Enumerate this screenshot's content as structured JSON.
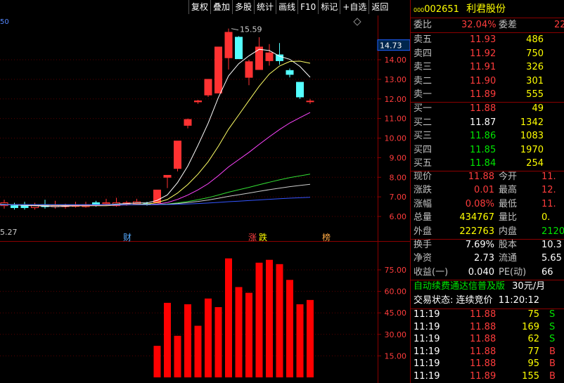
{
  "toolbar": [
    "复权",
    "叠加",
    "多股",
    "统计",
    "画线",
    "F10",
    "标记",
    "+自选",
    "返回"
  ],
  "stock": {
    "code_prefix": "000",
    "code": "002651",
    "name": "利君股份"
  },
  "weibi": {
    "label": "委比",
    "value": "32.04%",
    "label2": "委差",
    "value2": "22"
  },
  "sell": [
    {
      "label": "卖五",
      "price": "11.93",
      "vol": "486"
    },
    {
      "label": "卖四",
      "price": "11.92",
      "vol": "750"
    },
    {
      "label": "卖三",
      "price": "11.91",
      "vol": "326"
    },
    {
      "label": "卖二",
      "price": "11.90",
      "vol": "301"
    },
    {
      "label": "卖一",
      "price": "11.89",
      "vol": "555"
    }
  ],
  "buy": [
    {
      "label": "买一",
      "price": "11.88",
      "vol": "49"
    },
    {
      "label": "买二",
      "price": "11.87",
      "vol": "1342"
    },
    {
      "label": "买三",
      "price": "11.86",
      "vol": "1083"
    },
    {
      "label": "买四",
      "price": "11.85",
      "vol": "1970"
    },
    {
      "label": "买五",
      "price": "11.84",
      "vol": "254"
    }
  ],
  "quote": [
    {
      "l1": "现价",
      "v1": "11.88",
      "l2": "今开",
      "v2": "11."
    },
    {
      "l1": "涨跌",
      "v1": "0.01",
      "l2": "最高",
      "v2": "12."
    },
    {
      "l1": "涨幅",
      "v1": "0.08%",
      "l2": "最低",
      "v2": "11."
    },
    {
      "l1": "总量",
      "v1": "434767",
      "l2": "量比",
      "v2": "0."
    },
    {
      "l1": "外盘",
      "v1": "222763",
      "l2": "内盘",
      "v2": "2120"
    }
  ],
  "stats": [
    {
      "l1": "换手",
      "v1": "7.69%",
      "l2": "股本",
      "v2": "10.3"
    },
    {
      "l1": "净资",
      "v1": "2.73",
      "l2": "流通",
      "v2": "5.65"
    },
    {
      "l1": "收益(一)",
      "v1": "0.040",
      "l2": "PE(动)",
      "v2": "66"
    }
  ],
  "ad": {
    "text": "自动续费通达信普及版",
    "price": "30元/月"
  },
  "trade_status": {
    "label": "交易状态:",
    "value": "连续竞价",
    "time": "11:20:12"
  },
  "ticks": [
    {
      "time": "11:19",
      "price": "11.88",
      "vol": "75",
      "side": "S"
    },
    {
      "time": "11:19",
      "price": "11.88",
      "vol": "169",
      "side": "S"
    },
    {
      "time": "11:19",
      "price": "11.88",
      "vol": "62",
      "side": "S"
    },
    {
      "time": "11:19",
      "price": "11.88",
      "vol": "77",
      "side": "B"
    },
    {
      "time": "11:19",
      "price": "11.88",
      "vol": "95",
      "side": "B"
    },
    {
      "time": "11:19",
      "price": "11.89",
      "vol": "155",
      "side": "B"
    }
  ],
  "kline": {
    "price_axis": [
      "14.00",
      "13.00",
      "12.00",
      "11.00",
      "10.00",
      "9.00",
      "8.00",
      "7.00",
      "6.00"
    ],
    "current_price_tag": "14.73",
    "high_label": "15.59",
    "low_label": "5.27",
    "top_left_label": "50",
    "markers": [
      {
        "text": "财",
        "color": "#55aaff"
      },
      {
        "text": "涨",
        "color": "#ff4040"
      },
      {
        "text": "跌",
        "color": "#ffff00"
      },
      {
        "text": "榜",
        "color": "#ffaa44"
      }
    ],
    "candles": [
      {
        "o": 6.55,
        "c": 6.7,
        "h": 6.85,
        "l": 6.4
      },
      {
        "o": 6.55,
        "c": 6.45,
        "h": 6.7,
        "l": 6.35
      },
      {
        "o": 6.6,
        "c": 6.45,
        "h": 6.75,
        "l": 6.35
      },
      {
        "o": 6.45,
        "c": 6.55,
        "h": 6.7,
        "l": 6.35
      },
      {
        "o": 6.6,
        "c": 6.5,
        "h": 6.85,
        "l": 6.4
      },
      {
        "o": 6.5,
        "c": 6.55,
        "h": 6.8,
        "l": 6.4
      },
      {
        "o": 6.5,
        "c": 6.55,
        "h": 6.65,
        "l": 6.4
      },
      {
        "o": 6.55,
        "c": 6.55,
        "h": 6.75,
        "l": 6.45
      },
      {
        "o": 6.5,
        "c": 6.6,
        "h": 6.75,
        "l": 6.45
      },
      {
        "o": 6.7,
        "c": 6.6,
        "h": 6.8,
        "l": 6.5
      },
      {
        "o": 6.65,
        "c": 6.7,
        "h": 6.9,
        "l": 6.55
      },
      {
        "o": 6.55,
        "c": 6.7,
        "h": 6.95,
        "l": 6.5
      },
      {
        "o": 6.65,
        "c": 6.7,
        "h": 6.8,
        "l": 6.55
      },
      {
        "o": 6.65,
        "c": 6.75,
        "h": 6.9,
        "l": 6.6
      },
      {
        "o": 6.65,
        "c": 6.6,
        "h": 6.75,
        "l": 6.55
      },
      {
        "o": 6.7,
        "c": 7.35,
        "h": 7.35,
        "l": 6.7
      },
      {
        "o": 8.0,
        "c": 8.1,
        "h": 8.1,
        "l": 7.45
      },
      {
        "o": 8.45,
        "c": 9.85,
        "h": 9.85,
        "l": 8.3
      },
      {
        "o": 10.65,
        "c": 10.95,
        "h": 11.0,
        "l": 10.5
      },
      {
        "o": 11.85,
        "c": 11.9,
        "h": 11.95,
        "l": 11.75
      },
      {
        "o": 12.2,
        "c": 13.0,
        "h": 13.0,
        "l": 12.1
      },
      {
        "o": 12.3,
        "c": 14.65,
        "h": 14.65,
        "l": 12.3
      },
      {
        "o": 14.1,
        "c": 15.4,
        "h": 15.59,
        "l": 13.5
      },
      {
        "o": 15.15,
        "c": 14.05,
        "h": 15.2,
        "l": 14.05
      },
      {
        "o": 13.1,
        "c": 13.9,
        "h": 14.0,
        "l": 12.7
      },
      {
        "o": 13.5,
        "c": 14.65,
        "h": 15.15,
        "l": 13.5
      },
      {
        "o": 13.95,
        "c": 14.35,
        "h": 14.8,
        "l": 13.7
      },
      {
        "o": 14.25,
        "c": 13.95,
        "h": 14.85,
        "l": 13.75
      },
      {
        "o": 13.45,
        "c": 13.25,
        "h": 13.55,
        "l": 13.1
      },
      {
        "o": 12.85,
        "c": 12.1,
        "h": 12.85,
        "l": 12.0
      },
      {
        "o": 11.88,
        "c": 11.89,
        "h": 12.0,
        "l": 11.75
      }
    ]
  },
  "volume": {
    "axis": [
      "75.00",
      "60.00",
      "45.00",
      "30.00",
      "15.00"
    ],
    "values": [
      22,
      52,
      29,
      51,
      36,
      55,
      49,
      83,
      63,
      59,
      80,
      82,
      79,
      68,
      51,
      54
    ]
  }
}
